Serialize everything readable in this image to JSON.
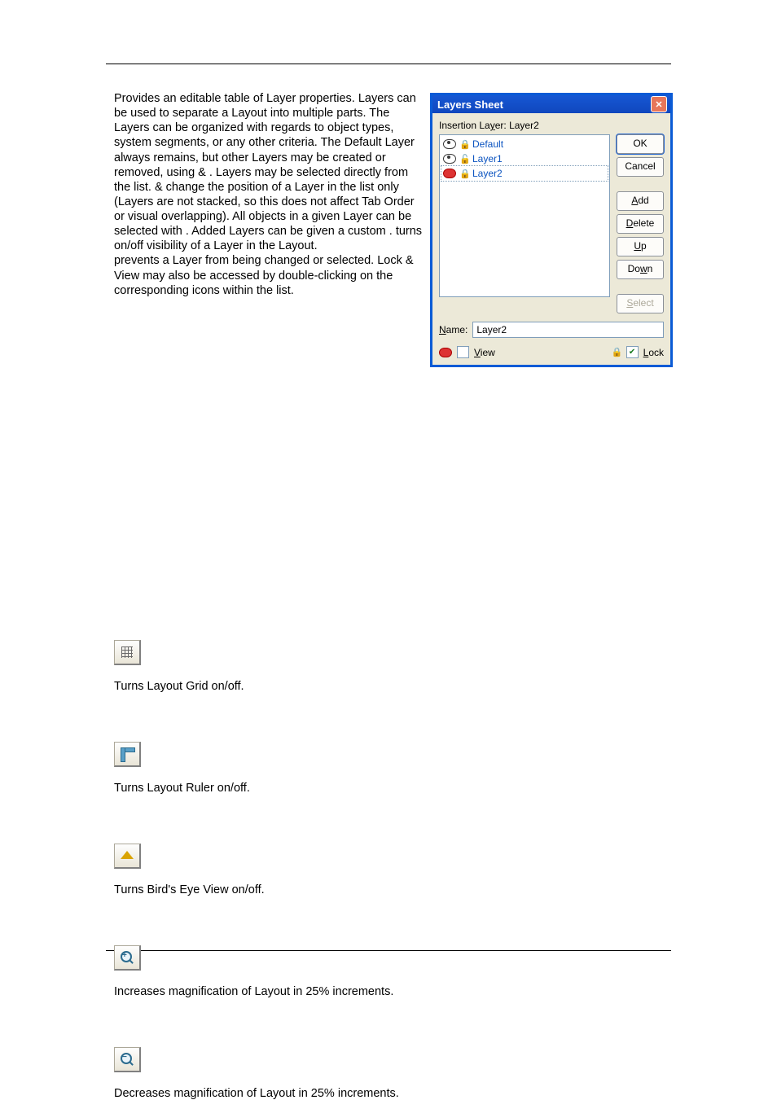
{
  "para1_part1": "Provides an editable table of Layer properties. Layers can be used to separate a Layout into multiple parts. The Layers can be organized with regards to object types, system segments, or any other criteria. The Default Layer always remains, but other Layers may be created or removed, using ",
  "para1_amp1": " & ",
  "para1_part2": ". Layers may be selected directly from the list. ",
  "para1_amp2": " & ",
  "para1_part3": " change the position of a Layer in the list only (Layers are not stacked, so this does not affect Tab Order or visual overlapping). All objects in a given Layer can be selected with ",
  "para1_part4": ". Added Layers can be given a custom ",
  "para1_part5": ". ",
  "para1_part6": " turns on/off visibility of a Layer in the Layout.",
  "para2": " prevents a Layer from being changed or selected. Lock & View may also be accessed by double-clicking on the corresponding icons within the list.",
  "dialog": {
    "title": "Layers Sheet",
    "insertion_label": "Insertion La",
    "insertion_label_u": "y",
    "insertion_label_after": "er:  ",
    "insertion_value": "Layer2",
    "layers": [
      {
        "name": "Default",
        "visible": true,
        "locked": true,
        "selected": false
      },
      {
        "name": "Layer1",
        "visible": true,
        "locked": false,
        "selected": false
      },
      {
        "name": "Layer2",
        "visible": false,
        "locked": true,
        "selected": true
      }
    ],
    "buttons": {
      "ok": "OK",
      "cancel": "Cancel",
      "add": "Add",
      "delete": "Delete",
      "up": "Up",
      "down": "Down",
      "select": "Select"
    },
    "name_label": "Name:",
    "name_value": "Layer2",
    "view_label": "View",
    "lock_label": "Lock",
    "view_checked": false,
    "lock_checked": true
  },
  "sections": {
    "grid": "Turns Layout Grid on/off.",
    "ruler": "Turns Layout Ruler on/off.",
    "bird": "Turns Bird's Eye View on/off.",
    "zoom_in": "Increases magnification of Layout in 25% increments.",
    "zoom_out": "Decreases magnification of Layout in 25% increments."
  }
}
